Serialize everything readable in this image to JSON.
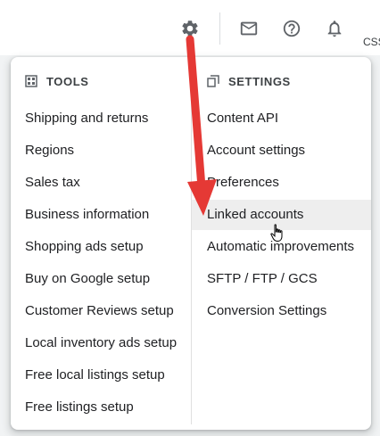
{
  "topbar": {
    "icons": [
      "gear-icon",
      "mail-icon",
      "help-icon",
      "bell-icon"
    ],
    "right_label": "CSS"
  },
  "menu": {
    "tools": {
      "header": "TOOLS",
      "icon": "tools-grid-icon",
      "items": [
        "Shipping and returns",
        "Regions",
        "Sales tax",
        "Business information",
        "Shopping ads setup",
        "Buy on Google setup",
        "Customer Reviews setup",
        "Local inventory ads setup",
        "Free local listings setup",
        "Free listings setup"
      ]
    },
    "settings": {
      "header": "SETTINGS",
      "icon": "settings-copy-icon",
      "items": [
        "Content API",
        "Account settings",
        "Preferences",
        "Linked accounts",
        "Automatic improvements",
        "SFTP / FTP / GCS",
        "Conversion Settings"
      ],
      "hovered_item": "Linked accounts"
    }
  },
  "colors": {
    "annotation_arrow": "#e53935",
    "hover_bg": "#eeeeee",
    "text": "#202124",
    "icon": "#5f6368"
  }
}
